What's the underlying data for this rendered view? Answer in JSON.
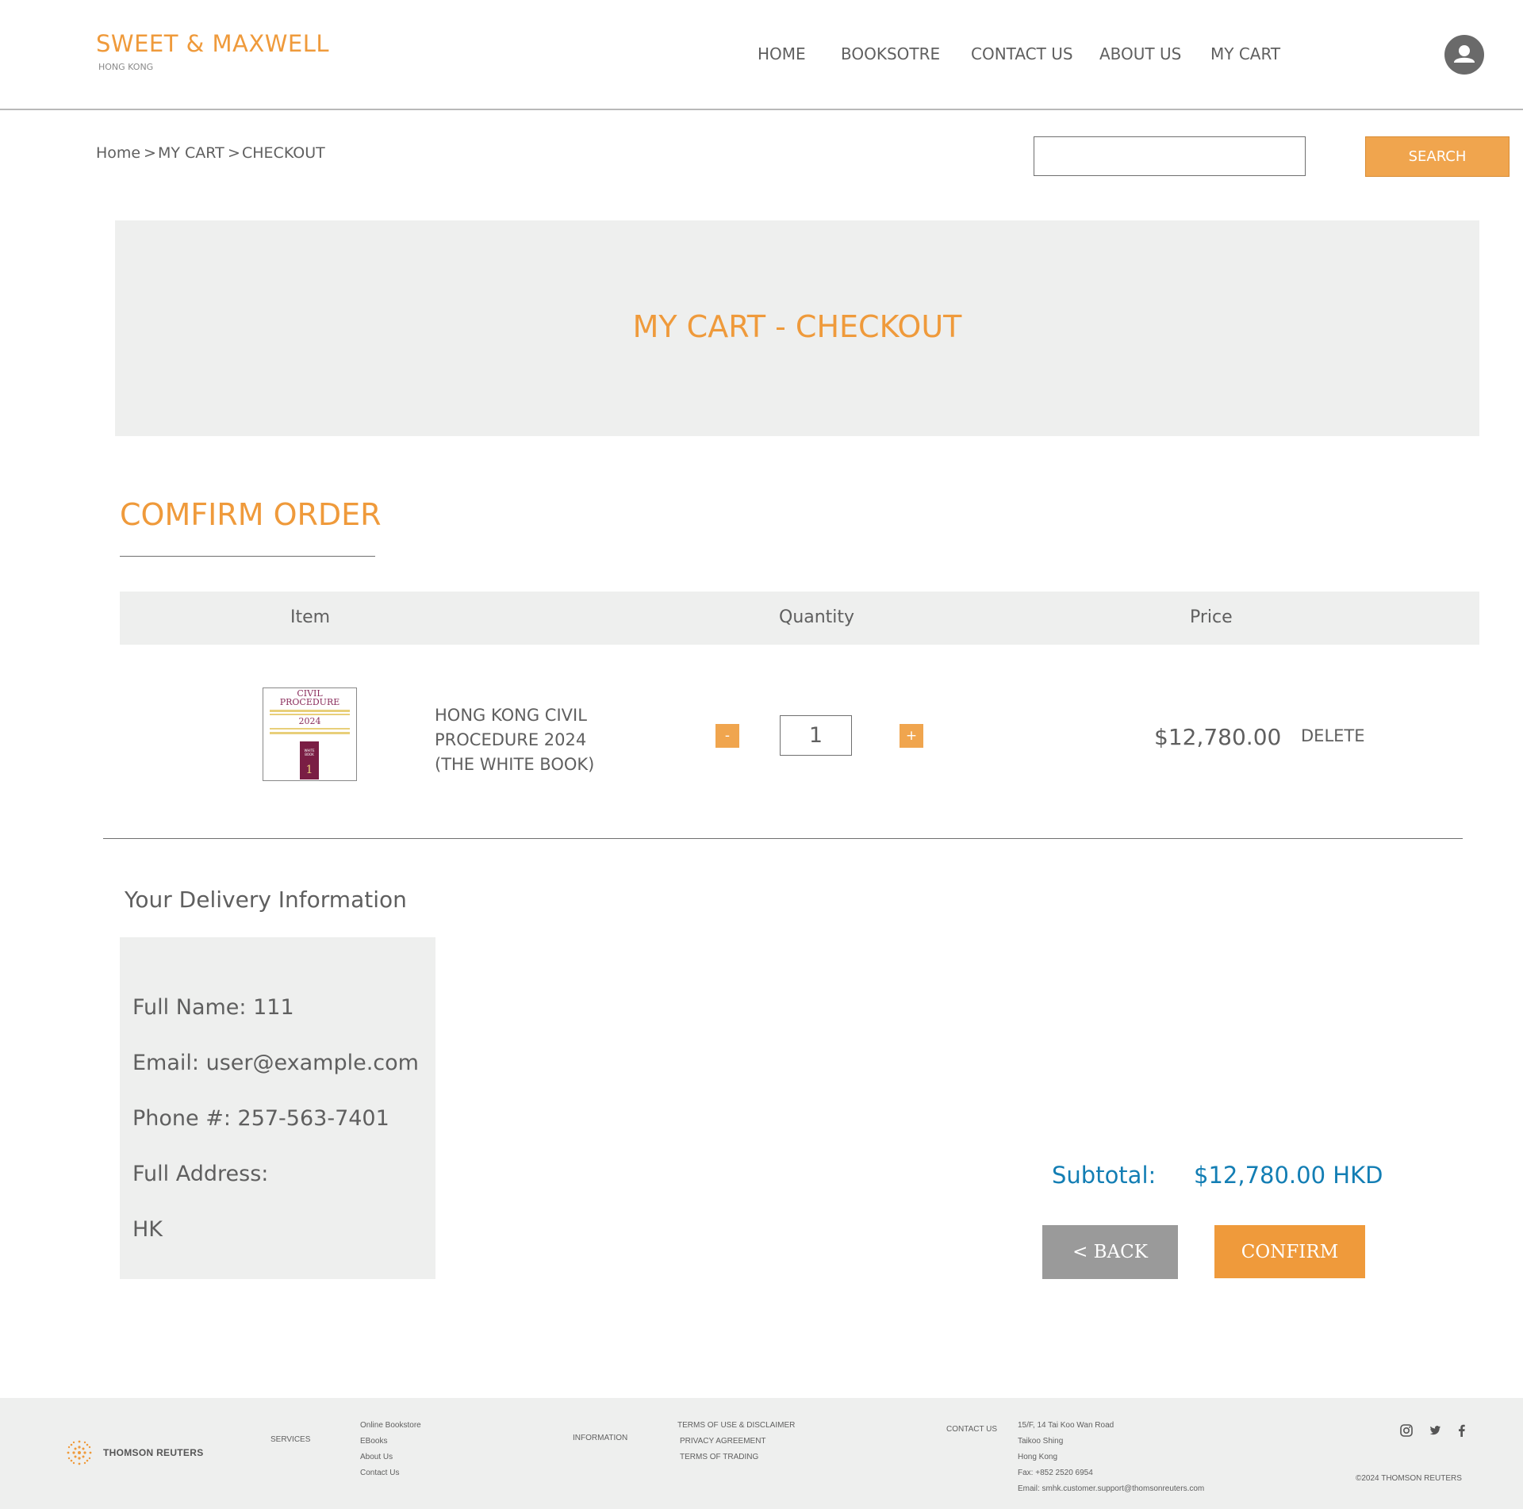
{
  "header": {
    "logo_main": "SWEET & MAXWELL",
    "logo_sub": "HONG KONG",
    "nav": [
      "HOME",
      "BOOKSOTRE",
      "CONTACT US",
      "ABOUT US",
      "MY CART"
    ]
  },
  "breadcrumb": {
    "home": "Home",
    "sep": ">",
    "cart": "MY CART",
    "checkout": "CHECKOUT"
  },
  "search": {
    "value": "",
    "button": "SEARCH"
  },
  "banner": {
    "title": "MY CART - CHECKOUT"
  },
  "order": {
    "title": "COMFIRM ORDER",
    "columns": {
      "item": "Item",
      "quantity": "Quantity",
      "price": "Price"
    },
    "items": [
      {
        "name": "HONG KONG CIVIL PROCEDURE 2024 (THE WHITE BOOK)",
        "cover_line1": "CIVIL",
        "cover_line2": "PROCEDURE",
        "cover_year": "2024",
        "cover_book_label": "WHITE BOOK",
        "cover_volume": "1",
        "minus": "-",
        "quantity": "1",
        "plus": "+",
        "price": "$12,780.00",
        "delete": "DELETE"
      }
    ]
  },
  "delivery": {
    "title": "Your Delivery Information",
    "full_name": "Full Name: 111",
    "email": "Email: user@example.com",
    "phone": "Phone #: 257-563-7401",
    "address_label": "Full Address:",
    "address": "HK"
  },
  "totals": {
    "subtotal_label": "Subtotal:",
    "subtotal_value": "$12,780.00 HKD"
  },
  "actions": {
    "back": "< BACK",
    "confirm": "CONFIRM"
  },
  "footer": {
    "brand": "THOMSON REUTERS",
    "services_label": "SERVICES",
    "services": [
      "Online Bookstore",
      "EBooks",
      "About Us",
      "Contact Us"
    ],
    "information_label": "INFORMATION",
    "information": [
      "TERMS OF USE & DISCLAIMER",
      "PRIVACY AGREEMENT",
      "TERMS OF TRADING"
    ],
    "contact_label": "CONTACT US",
    "contact": [
      "15/F, 14 Tai Koo Wan Road",
      "Taikoo Shing",
      "Hong Kong",
      "Fax: +852 2520 6954",
      "Email: smhk.customer.support@thomsonreuters.com"
    ],
    "copyright": "©2024 THOMSON REUTERS",
    "social_icons": [
      "instagram-icon",
      "twitter-icon",
      "facebook-icon"
    ]
  },
  "colors": {
    "accent": "#ef9a3b",
    "subtotal": "#137eb4",
    "panel": "#eeefee",
    "back_button": "#9a9a9a"
  }
}
